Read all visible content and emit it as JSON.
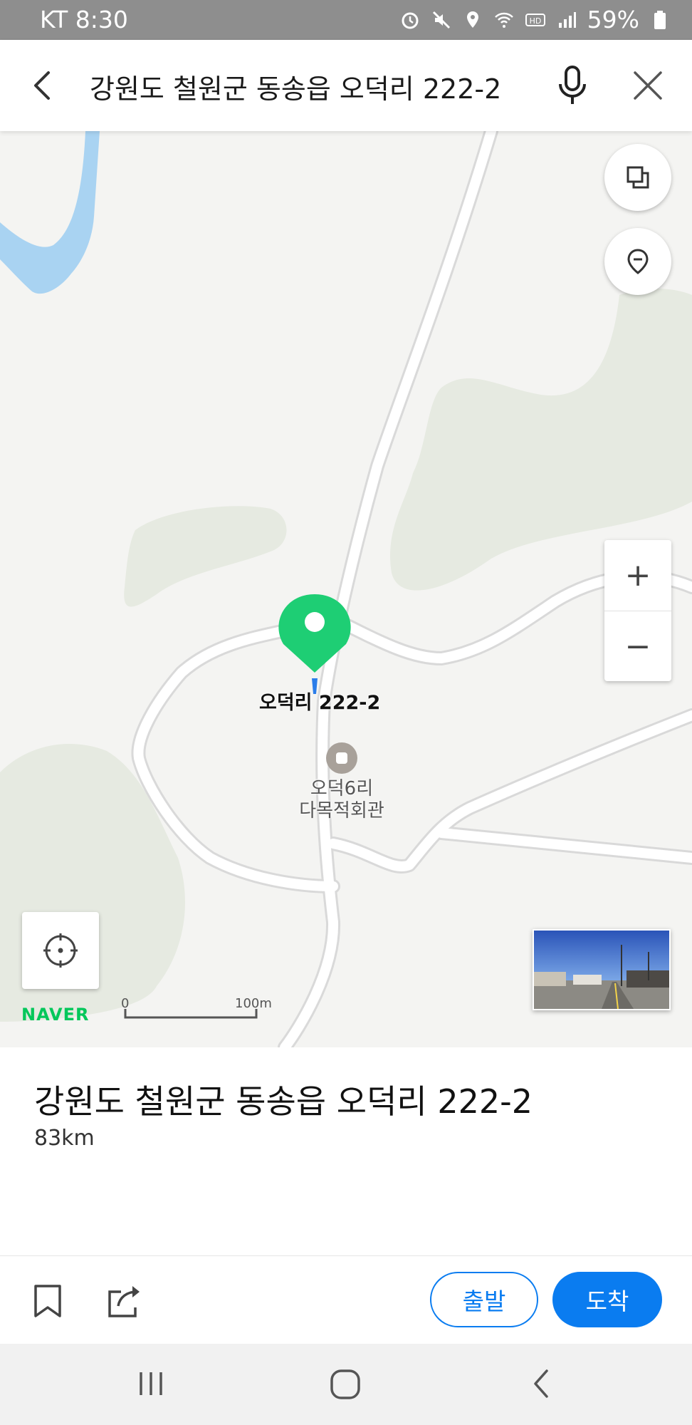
{
  "status_bar": {
    "carrier_time": "KT 8:30",
    "battery": "59%",
    "icons": [
      "alarm-icon",
      "mute-icon",
      "location-icon",
      "wifi-icon",
      "hd-icon",
      "signal-icon",
      "battery-icon"
    ]
  },
  "search": {
    "query": "강원도 철원군 동송읍 오덕리 222-2",
    "icons": [
      "back-arrow-icon",
      "microphone-icon",
      "close-icon"
    ]
  },
  "map": {
    "pin_label": "오덕리 222-2",
    "poi_line1": "오덕6리",
    "poi_line2": "다목적회관",
    "brand": "NAVER",
    "scale_start": "0",
    "scale_end": "100m",
    "zoom_in": "+",
    "zoom_out": "−",
    "colors": {
      "background": "#f4f4f2",
      "road": "#ffffff",
      "road_border": "#d9d9d9",
      "green_area": "#e6eae1",
      "water": "#a9d3f2",
      "pin": "#1ece74",
      "brand": "#03c75a"
    }
  },
  "place": {
    "title": "강원도 철원군 동송읍 오덕리 222-2",
    "distance": "83km"
  },
  "actions": {
    "depart": "출발",
    "arrive": "도착",
    "accent": "#0a7cf0"
  }
}
